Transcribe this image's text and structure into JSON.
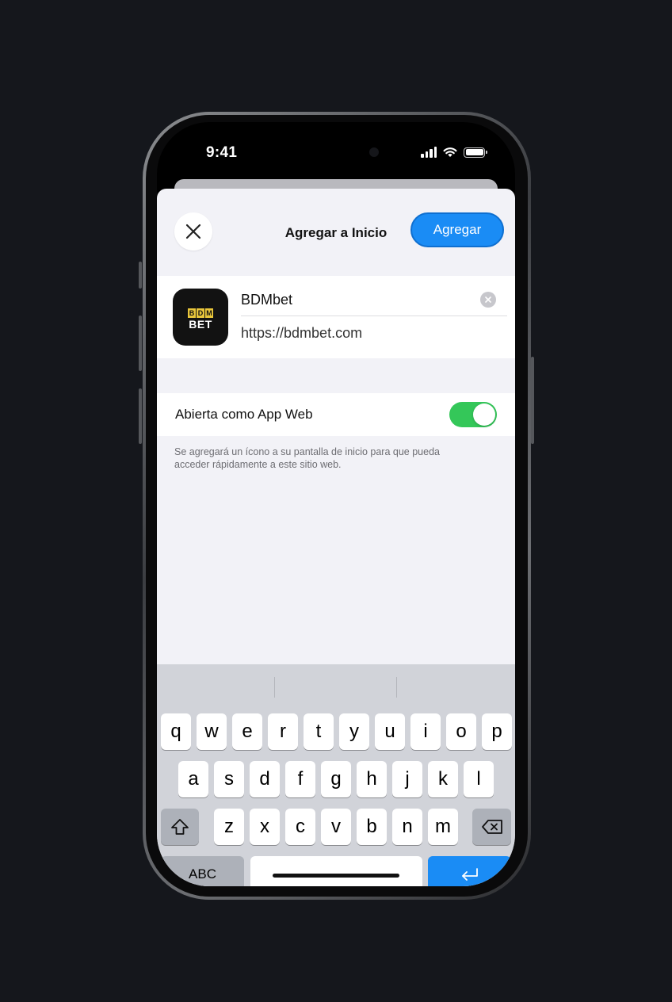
{
  "status_bar": {
    "time": "9:41"
  },
  "nav": {
    "title": "Agregar a Inicio",
    "add_label": "Agregar"
  },
  "app": {
    "logo_top_letters": [
      "B",
      "D",
      "M"
    ],
    "logo_bottom": "BET",
    "name": "BDMbet",
    "url": "https://bdmbet.com"
  },
  "settings": {
    "web_app_label": "Abierta como App Web",
    "web_app_enabled": true,
    "footnote": "Se agregará un ícono a su pantalla de inicio para que pueda acceder rápidamente a este sitio web."
  },
  "keyboard": {
    "row1": [
      "q",
      "w",
      "e",
      "r",
      "t",
      "y",
      "u",
      "i",
      "o",
      "p"
    ],
    "row2": [
      "a",
      "s",
      "d",
      "f",
      "g",
      "h",
      "j",
      "k",
      "l"
    ],
    "row3": [
      "z",
      "x",
      "c",
      "v",
      "b",
      "n",
      "m"
    ],
    "abc_label": "ABC",
    "icons": {
      "shift": "shift-icon",
      "delete": "delete-icon",
      "return": "return-icon",
      "emoji": "emoji-icon",
      "mic": "microphone-icon"
    }
  },
  "colors": {
    "accent": "#1a8cf5",
    "toggle_on": "#34c759",
    "sheet_bg": "#f2f2f7",
    "keyboard_bg": "#d1d3d9"
  }
}
